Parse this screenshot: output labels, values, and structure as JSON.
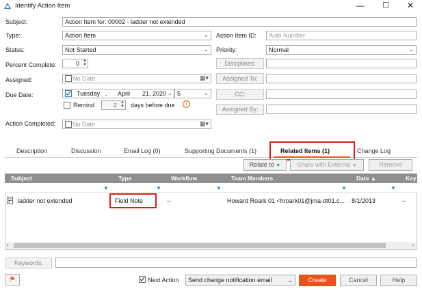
{
  "window": {
    "title": "Identify Action Item",
    "minimize": "—",
    "maximize": "☐",
    "close": "✕"
  },
  "form": {
    "subject_label": "Subject:",
    "subject_value": "Action Item for: 00002 - ladder not extended",
    "type_label": "Type:",
    "type_value": "Action Item",
    "status_label": "Status:",
    "status_value": "Not Started",
    "percent_label": "Percent Complete:",
    "percent_value": "0",
    "assigned_label": "Assigned:",
    "assigned_value": "No Date",
    "due_label": "Due Date:",
    "due_weekday": "Tuesday",
    "due_sep": ",",
    "due_month": "April",
    "due_daynum": "21, 2020",
    "due_time": "5",
    "remind_label": "Remind",
    "remind_value": "2",
    "remind_suffix": "days before due",
    "completed_label": "Action Completed:",
    "completed_value": "No Date",
    "item_id_label": "Action Item ID:",
    "item_id_placeholder": "Auto Number",
    "priority_label": "Priority:",
    "priority_value": "Normal",
    "disciplines_btn": "Disciplines:",
    "assigned_to_btn": "Assigned To:",
    "cc_btn": "CC:",
    "assigned_by_btn": "Assigned By:"
  },
  "tabs": [
    {
      "label": "Description"
    },
    {
      "label": "Discussion"
    },
    {
      "label": "Email Log (0)"
    },
    {
      "label": "Supporting Documents (1)"
    },
    {
      "label": "Related Items (1)"
    },
    {
      "label": "Change Log"
    }
  ],
  "toolbar": {
    "relate_to": "Relate to",
    "share_external": "Share with External",
    "remove": "Remove"
  },
  "grid": {
    "columns": [
      "Subject",
      "Type",
      "Workflow",
      "Team Members",
      "Date ▲",
      "Key"
    ],
    "rows": [
      {
        "subject": "ladder not extended",
        "type": "Field Note",
        "workflow": "--",
        "team": "Howard Roark 01 <hroark01@jma-dt01.c...",
        "date": "8/1/2013",
        "key": "--"
      }
    ]
  },
  "keywords_label": "Keywords:",
  "footer": {
    "next_action_label": "Next Action",
    "notify_value": "Send change notification email",
    "create": "Create",
    "cancel": "Cancel",
    "help": "Help"
  },
  "colors": {
    "accent": "#e8541c",
    "highlight": "#e01818",
    "header_bg": "#8f8f8f"
  }
}
